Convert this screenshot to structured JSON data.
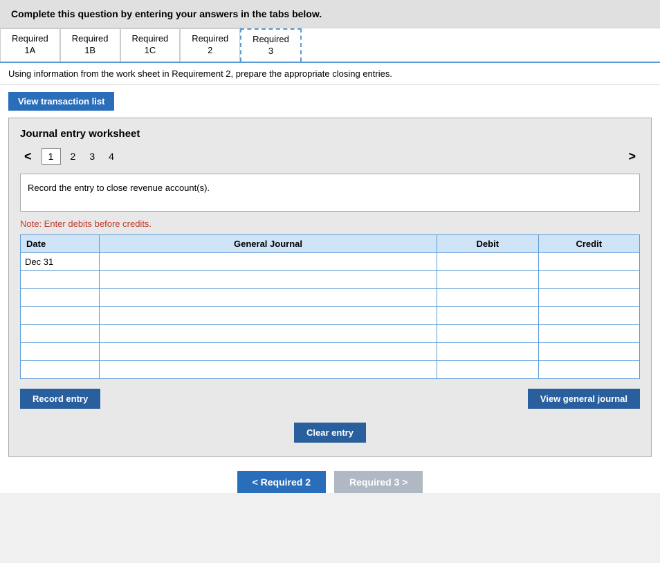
{
  "header": {
    "text": "Complete this question by entering your answers in the tabs below."
  },
  "tabs": [
    {
      "id": "tab-1a",
      "label": "Required\n1A",
      "active": false
    },
    {
      "id": "tab-1b",
      "label": "Required\n1B",
      "active": false
    },
    {
      "id": "tab-1c",
      "label": "Required\n1C",
      "active": false
    },
    {
      "id": "tab-2",
      "label": "Required\n2",
      "active": false
    },
    {
      "id": "tab-3",
      "label": "Required\n3",
      "active": true
    }
  ],
  "instruction": "Using information from the work sheet in Requirement 2, prepare the appropriate closing entries.",
  "view_transaction_btn": "View transaction list",
  "journal": {
    "title": "Journal entry worksheet",
    "nav": {
      "prev_arrow": "<",
      "next_arrow": ">",
      "pages": [
        "1",
        "2",
        "3",
        "4"
      ],
      "current": "1"
    },
    "entry_description": "Record the entry to close revenue account(s).",
    "note": "Note: Enter debits before credits.",
    "table": {
      "headers": [
        "Date",
        "General Journal",
        "Debit",
        "Credit"
      ],
      "rows": [
        {
          "date": "Dec 31",
          "gj": "",
          "debit": "",
          "credit": ""
        },
        {
          "date": "",
          "gj": "",
          "debit": "",
          "credit": ""
        },
        {
          "date": "",
          "gj": "",
          "debit": "",
          "credit": ""
        },
        {
          "date": "",
          "gj": "",
          "debit": "",
          "credit": ""
        },
        {
          "date": "",
          "gj": "",
          "debit": "",
          "credit": ""
        },
        {
          "date": "",
          "gj": "",
          "debit": "",
          "credit": ""
        },
        {
          "date": "",
          "gj": "",
          "debit": "",
          "credit": ""
        }
      ]
    },
    "record_btn": "Record entry",
    "clear_btn": "Clear entry",
    "view_gj_btn": "View general journal"
  },
  "bottom_nav": {
    "prev_label": "< Required 2",
    "next_label": "Required 3 >"
  }
}
